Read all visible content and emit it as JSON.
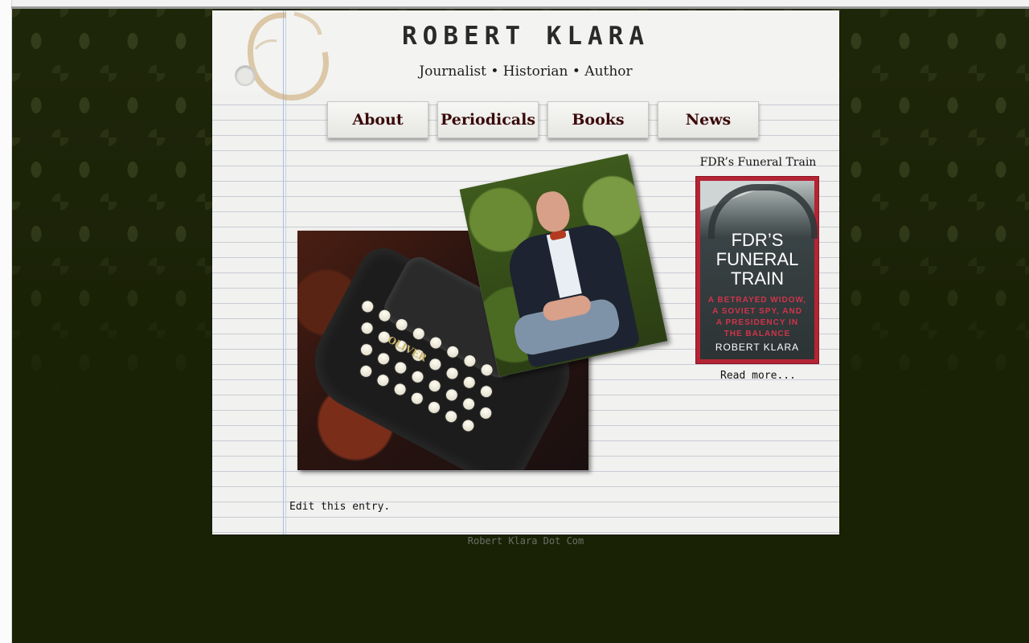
{
  "header": {
    "site_title": "ROBERT KLARA",
    "tagline": "Journalist • Historian • Author"
  },
  "nav": {
    "items": [
      {
        "label": "About"
      },
      {
        "label": "Periodicals"
      },
      {
        "label": "Books"
      },
      {
        "label": "News"
      }
    ]
  },
  "sidebar": {
    "title": "FDR’s Funeral Train",
    "book": {
      "title_line1": "FDR’S",
      "title_line2": "FUNERAL",
      "title_line3": "TRAIN",
      "subtitle_line1": "A BETRAYED WIDOW,",
      "subtitle_line2": "A SOVIET SPY, AND",
      "subtitle_line3": "A PRESIDENCY IN",
      "subtitle_line4": "THE BALANCE",
      "author": "ROBERT KLARA"
    },
    "read_more": "Read more..."
  },
  "photos": {
    "typewriter_brand": "OLIVER"
  },
  "content": {
    "edit_link": "Edit this entry."
  },
  "footer": {
    "text": "Robert Klara Dot Com"
  },
  "colors": {
    "background": "#1a2205",
    "paper": "#f1f1ef",
    "nav_text": "#3a0a0a",
    "book_border": "#b52434"
  }
}
